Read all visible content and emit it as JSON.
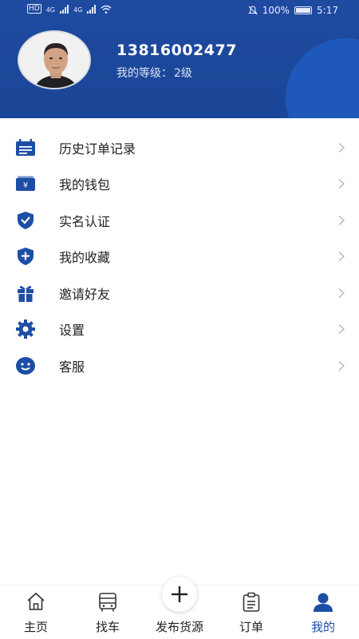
{
  "status_bar": {
    "left_label": "HD",
    "network": "4G",
    "battery": "100%",
    "time": "5:17"
  },
  "profile": {
    "username": "13816002477",
    "level_label": "我的等级：",
    "level_value": "2级"
  },
  "menu": [
    {
      "label": "历史订单记录",
      "icon": "calendar-icon"
    },
    {
      "label": "我的钱包",
      "icon": "wallet-icon"
    },
    {
      "label": "实名认证",
      "icon": "shield-check-icon"
    },
    {
      "label": "我的收藏",
      "icon": "shield-plus-icon"
    },
    {
      "label": "邀请好友",
      "icon": "gift-icon"
    },
    {
      "label": "设置",
      "icon": "gear-icon"
    },
    {
      "label": "客服",
      "icon": "smile-icon"
    }
  ],
  "bottom_nav": {
    "home": "主页",
    "find_vehicle": "找车",
    "publish": "发布货源",
    "orders": "订单",
    "mine": "我的",
    "active": "mine"
  },
  "colors": {
    "brand": "#1b4697",
    "icon": "#1d4ea5",
    "chevron": "#b5b5b5"
  }
}
